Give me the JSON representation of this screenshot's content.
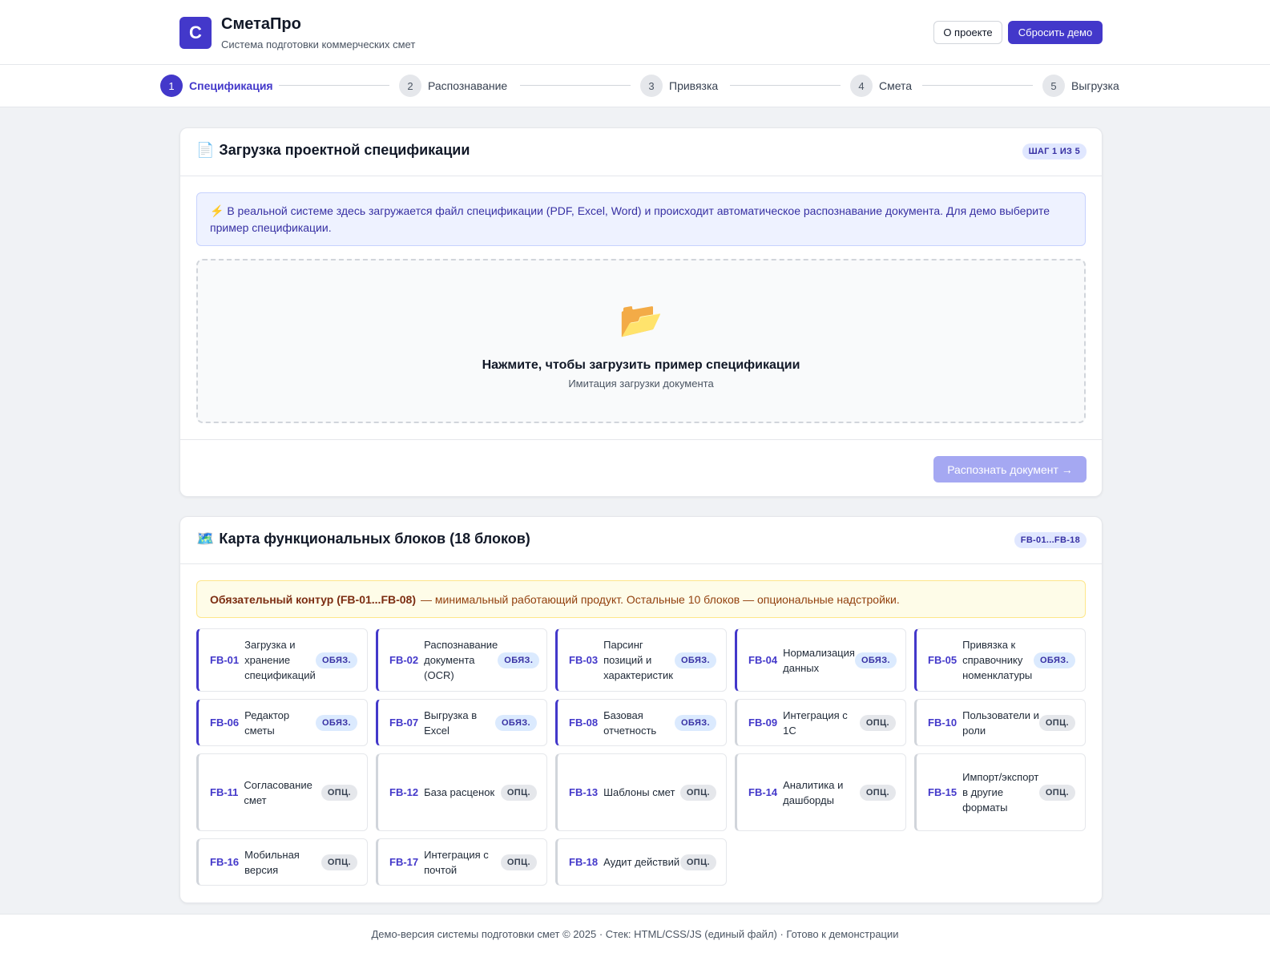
{
  "header": {
    "logo_letter": "С",
    "title": "СметаПро",
    "subtitle": "Система подготовки коммерческих смет",
    "about_label": "О проекте",
    "reset_label": "Сбросить демо"
  },
  "steps": [
    {
      "num": "1",
      "label": "Спецификация",
      "active": true
    },
    {
      "num": "2",
      "label": "Распознавание",
      "active": false
    },
    {
      "num": "3",
      "label": "Привязка",
      "active": false
    },
    {
      "num": "4",
      "label": "Смета",
      "active": false
    },
    {
      "num": "5",
      "label": "Выгрузка",
      "active": false
    }
  ],
  "upload_card": {
    "icon": "📄",
    "title": "Загрузка проектной спецификации",
    "badge": "ШАГ 1 ИЗ 5",
    "info": "⚡ В реальной системе здесь загружается файл спецификации (PDF, Excel, Word) и происходит автоматическое распознавание документа. Для демо выберите пример спецификации.",
    "drop_icon": "📂",
    "drop_title": "Нажмите, чтобы загрузить пример спецификации",
    "drop_subtitle": "Имитация загрузки документа",
    "recognize_label": "Распознать документ →"
  },
  "blocks_card": {
    "icon": "🗺️",
    "title": "Карта функциональных блоков (18 блоков)",
    "badge": "FB-01...FB-18",
    "notice_bold": "Обязательный контур (FB-01...FB-08)",
    "notice_text": "— минимальный работающий продукт. Остальные 10 блоков — опциональные надстройки.",
    "blocks": [
      {
        "code": "FB-01",
        "name": "Загрузка и хранение спецификаций",
        "tag": "ОБЯЗ.",
        "required": true
      },
      {
        "code": "FB-02",
        "name": "Распознавание документа (OCR)",
        "tag": "ОБЯЗ.",
        "required": true
      },
      {
        "code": "FB-03",
        "name": "Парсинг позиций и характеристик",
        "tag": "ОБЯЗ.",
        "required": true
      },
      {
        "code": "FB-04",
        "name": "Нормализация данных",
        "tag": "ОБЯЗ.",
        "required": true
      },
      {
        "code": "FB-05",
        "name": "Привязка к справочнику номенклатуры",
        "tag": "ОБЯЗ.",
        "required": true
      },
      {
        "code": "FB-06",
        "name": "Редактор сметы",
        "tag": "ОБЯЗ.",
        "required": true
      },
      {
        "code": "FB-07",
        "name": "Выгрузка в Excel",
        "tag": "ОБЯЗ.",
        "required": true
      },
      {
        "code": "FB-08",
        "name": "Базовая отчетность",
        "tag": "ОБЯЗ.",
        "required": true
      },
      {
        "code": "FB-09",
        "name": "Интеграция с 1С",
        "tag": "ОПЦ.",
        "required": false
      },
      {
        "code": "FB-10",
        "name": "Пользователи и роли",
        "tag": "ОПЦ.",
        "required": false
      },
      {
        "code": "FB-11",
        "name": "Согласование смет",
        "tag": "ОПЦ.",
        "required": false
      },
      {
        "code": "FB-12",
        "name": "База расценок",
        "tag": "ОПЦ.",
        "required": false
      },
      {
        "code": "FB-13",
        "name": "Шаблоны смет",
        "tag": "ОПЦ.",
        "required": false
      },
      {
        "code": "FB-14",
        "name": "Аналитика и дашборды",
        "tag": "ОПЦ.",
        "required": false
      },
      {
        "code": "FB-15",
        "name": "Импорт/экспорт в другие форматы",
        "tag": "ОПЦ.",
        "required": false
      },
      {
        "code": "FB-16",
        "name": "Мобильная версия",
        "tag": "ОПЦ.",
        "required": false
      },
      {
        "code": "FB-17",
        "name": "Интеграция с почтой",
        "tag": "ОПЦ.",
        "required": false
      },
      {
        "code": "FB-18",
        "name": "Аудит действий",
        "tag": "ОПЦ.",
        "required": false
      }
    ]
  },
  "footer": {
    "text": "Демо-версия системы подготовки смет © 2025 · Стек: HTML/CSS/JS (единый файл) · Готово к демонстрации"
  },
  "colors": {
    "accent": "#4338ca",
    "accent_disabled": "#a5a8f2",
    "info_bg": "#eef2ff",
    "warn_bg": "#fefce8"
  }
}
